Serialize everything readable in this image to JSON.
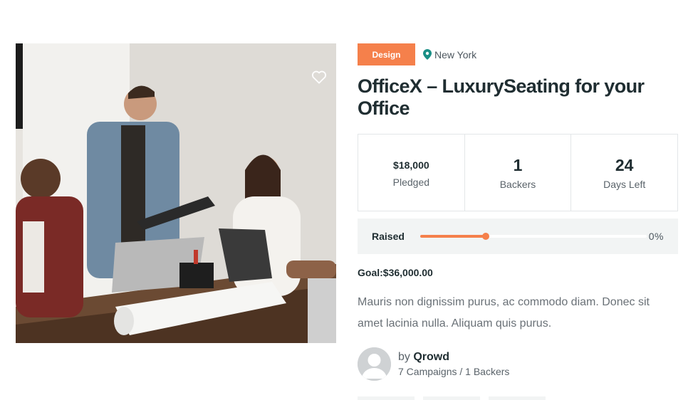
{
  "image": {
    "alt": "Team meeting around an office table"
  },
  "favorite": {
    "icon": "heart-outline-icon"
  },
  "category": {
    "label": "Design",
    "color": "#f5804b"
  },
  "location": {
    "icon": "map-pin-icon",
    "label": "New York",
    "color": "#1a8f86"
  },
  "campaign": {
    "title": "OfficeX – LuxurySeating for your Office"
  },
  "stats": [
    {
      "value": "$18,000",
      "label": "Pledged"
    },
    {
      "value": "1",
      "label": "Backers"
    },
    {
      "value": "24",
      "label": "Days Left"
    }
  ],
  "raised": {
    "label": "Raised",
    "percent_text": "0%",
    "progress": 0.29
  },
  "goal": {
    "text": "Goal:$36,000.00"
  },
  "description": "Mauris non dignissim purus, ac commodo diam. Donec sit amet lacinia nulla. Aliquam quis purus.",
  "author": {
    "prefix": "by ",
    "name": "Qrowd",
    "summary": "7 Campaigns / 1 Backers",
    "avatar_icon": "user-avatar-icon"
  }
}
